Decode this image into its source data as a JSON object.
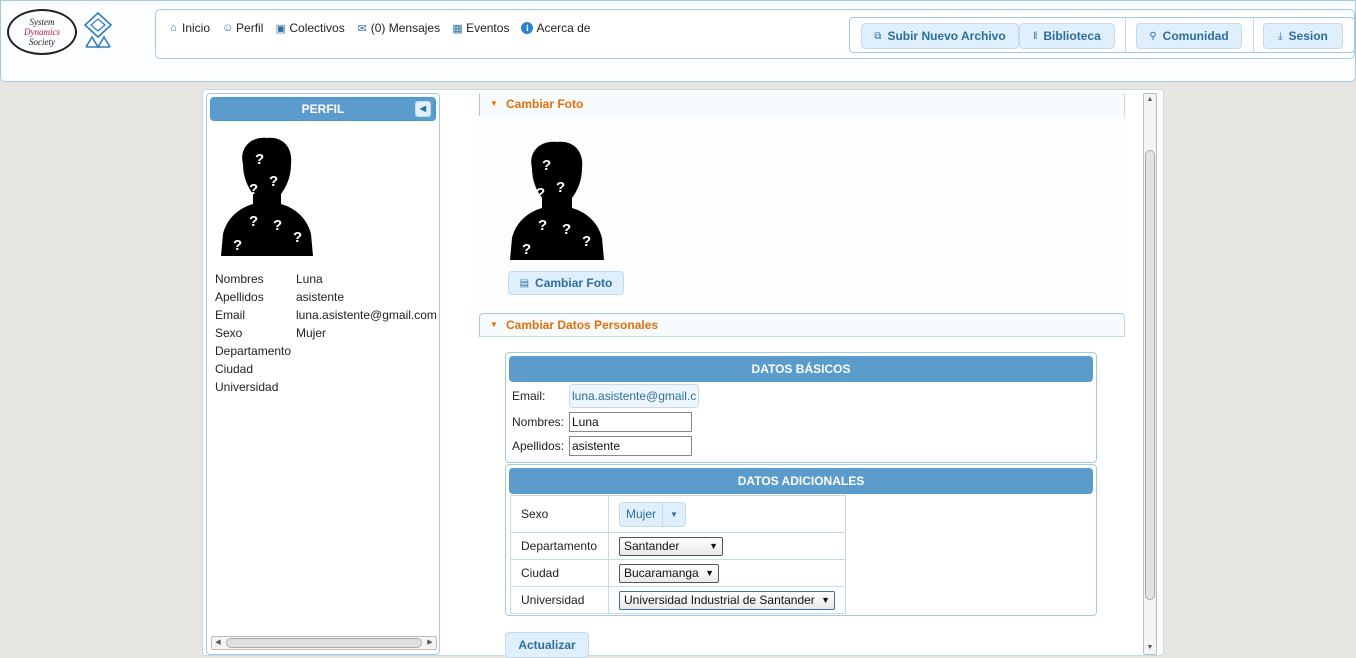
{
  "logo": {
    "line1": "System",
    "line2": "Dynamics",
    "line3": "Society"
  },
  "nav": {
    "inicio": "Inicio",
    "perfil": "Perfil",
    "colectivos": "Colectivos",
    "mensajes": "(0) Mensajes",
    "eventos": "Eventos",
    "acerca": "Acerca de",
    "info_glyph": "i"
  },
  "toolbar": {
    "subir": "Subir Nuevo Archivo",
    "biblioteca": "Biblioteca",
    "comunidad": "Comunidad",
    "sesion": "Sesion"
  },
  "sidebar": {
    "title": "PERFIL",
    "fields": [
      {
        "label": "Nombres",
        "value": "Luna"
      },
      {
        "label": "Apellidos",
        "value": "asistente"
      },
      {
        "label": "Email",
        "value": "luna.asistente@gmail.com"
      },
      {
        "label": "Sexo",
        "value": "Mujer"
      },
      {
        "label": "Departamento",
        "value": ""
      },
      {
        "label": "Ciudad",
        "value": ""
      },
      {
        "label": "Universidad",
        "value": ""
      }
    ]
  },
  "cambiar_foto": {
    "header": "Cambiar Foto",
    "button": "Cambiar Foto"
  },
  "datos_personales": {
    "header": "Cambiar Datos Personales",
    "basicos": {
      "title": "DATOS BÁSICOS",
      "email_label": "Email:",
      "email_value": "luna.asistente@gmail.com",
      "nombres_label": "Nombres:",
      "nombres_value": "Luna",
      "apellidos_label": "Apellidos:",
      "apellidos_value": "asistente"
    },
    "adicionales": {
      "title": "DATOS ADICIONALES",
      "sexo_label": "Sexo",
      "sexo_value": "Mujer",
      "departamento_label": "Departamento",
      "departamento_value": "Santander",
      "ciudad_label": "Ciudad",
      "ciudad_value": "Bucaramanga",
      "universidad_label": "Universidad",
      "universidad_value": "Universidad Industrial de Santander"
    },
    "actualizar": "Actualizar"
  },
  "icons": {
    "dropdown": "▼",
    "collapse": "◀",
    "expand_arrow": "▼"
  },
  "colors": {
    "accent_blue": "#5c9ccc",
    "accent_orange": "#e17009",
    "button_bg": "#dfeffc",
    "button_text": "#2e6e9e"
  }
}
